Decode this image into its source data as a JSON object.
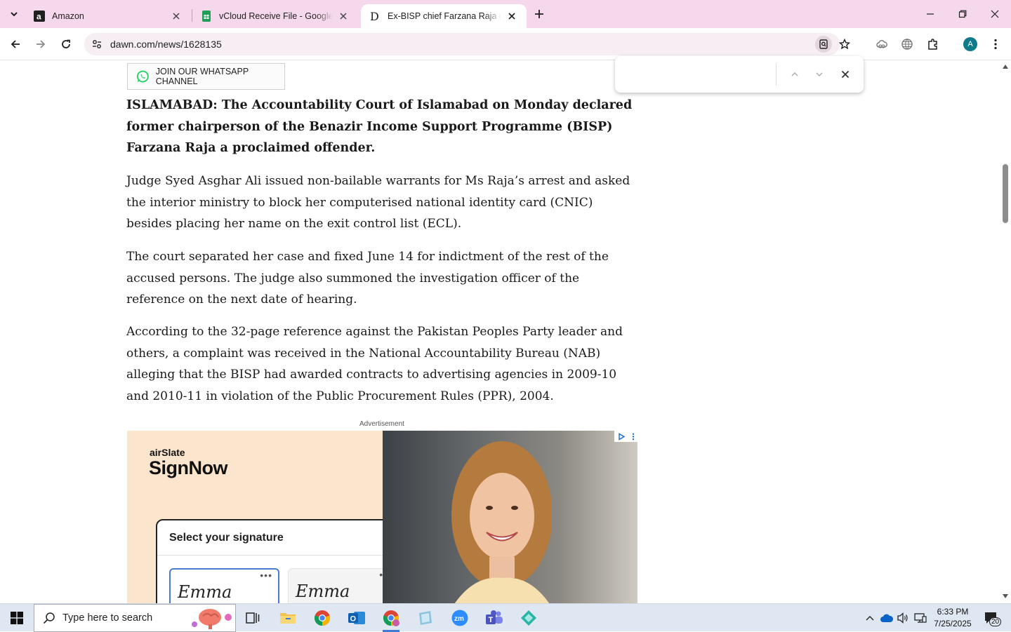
{
  "tabs": [
    {
      "title": "Amazon",
      "favicon": "amazon-icon"
    },
    {
      "title": "vCloud Receive File - Google Sheets",
      "favicon": "google-sheets-icon"
    },
    {
      "title": "Ex-BISP chief Farzana Raja declared proclaimed offender",
      "favicon": "dawn-icon",
      "active": true
    }
  ],
  "toolbar": {
    "url": "dawn.com/news/1628135",
    "profile_initial": "A"
  },
  "find_bar": {
    "query": ""
  },
  "page": {
    "whatsapp_label": "JOIN OUR WHATSAPP CHANNEL",
    "lead": "ISLAMABAD: The Accountability Court of Islamabad on Monday declared former chairperson of the Benazir Income Support Programme (BISP) Farzana Raja a proclaimed offender.",
    "paragraphs": [
      "Judge Syed Asghar Ali issued non-bailable warrants for Ms Raja’s arrest and asked the interior ministry to block her computerised national identity card (CNIC) besides placing her name on the exit control list (ECL).",
      "The court separated her case and fixed June 14 for indictment of the rest of the accused persons. The judge also summoned the investigation officer of the reference on the next date of hearing.",
      "According to the 32-page reference against the Pakistan Peoples Party leader and others, a complaint was received in the National Accountability Bureau (NAB) alleging that the BISP had awarded contracts to advertising agencies in 2009-10 and 2010-11 in violation of the Public Procurement Rules (PPR), 2004."
    ],
    "ad_label": "Advertisement",
    "ad": {
      "brand_small": "airSlate",
      "brand_big": "SignNow",
      "card_title": "Select your signature",
      "signature_1": "Emma Stone",
      "signature_2": "Emma Stone",
      "option_dots": "•••"
    }
  },
  "taskbar": {
    "search_placeholder": "Type here to search",
    "time": "6:33 PM",
    "date": "7/25/2025",
    "notification_count": "20"
  },
  "colors": {
    "tabstrip": "#f6d8ec",
    "omnibox": "#f6eef3",
    "taskbar": "#dfe7f2",
    "ad_bg": "#fbe5cd",
    "whatsapp": "#25d366"
  }
}
